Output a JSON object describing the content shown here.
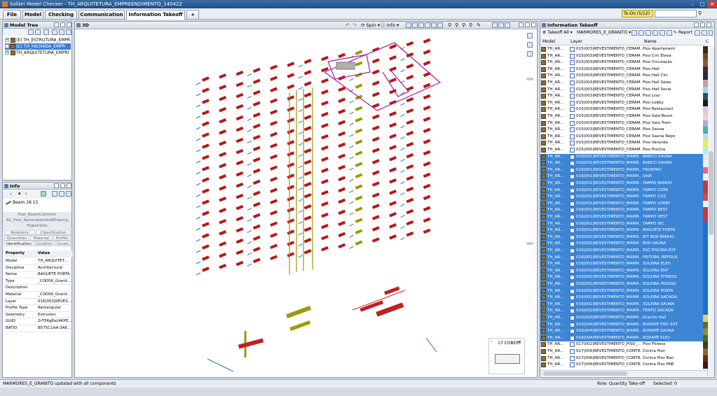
{
  "app": {
    "title": "Solibri Model Checker - TH_ARQUITETURA_EMPREENDIMENTO_140422"
  },
  "tabs": [
    {
      "label": "File"
    },
    {
      "label": "Model"
    },
    {
      "label": "Checking"
    },
    {
      "label": "Communication"
    },
    {
      "label": "Information Takeoff"
    },
    {
      "label": "+"
    }
  ],
  "todo": {
    "label": "To-Do (5/12)"
  },
  "model_tree": {
    "title": "Model Tree",
    "items": [
      {
        "label": "(E) TH_ESTRUTURA_EMPR"
      },
      {
        "label": "(C) TH_FACHADA_EMPR"
      },
      {
        "label": "TH_ARQUITETURA_EMPRI"
      }
    ]
  },
  "info": {
    "title": "Info",
    "selected": "Beam.18.15",
    "sections": [
      "Pset_BeamCommon",
      "AC_Pset_RenovationAndPhasing",
      "Hyperlinks"
    ],
    "tabs_row1": [
      "Relations",
      "Classification"
    ],
    "tabs_row2": [
      "Quantities",
      "Material",
      "Profile"
    ],
    "tabs_row3": [
      "Identification",
      "Location",
      "Issues"
    ],
    "col_property": "Property",
    "col_value": "Value",
    "properties": [
      {
        "p": "Model",
        "v": "TH_ARQUITET..."
      },
      {
        "p": "Discipline",
        "v": "Architectural"
      },
      {
        "p": "Name",
        "v": "BAGUETE PORTA"
      },
      {
        "p": "Type",
        "v": "_COD56_Granit..."
      },
      {
        "p": "Description",
        "v": ""
      },
      {
        "p": "Material",
        "v": "_COD56_Granit..."
      },
      {
        "p": "Layer",
        "v": "016|002|REVES..."
      },
      {
        "p": "Profile Type",
        "v": "Rectangular"
      },
      {
        "p": "Geometry",
        "v": "Extrusion"
      },
      {
        "p": "GUID",
        "v": "2rT56gEeL4KPE..."
      },
      {
        "p": "BATID",
        "v": "B575C1AA-3A8..."
      }
    ]
  },
  "view3d": {
    "title": "3D",
    "spin": "Spin",
    "info": "Info",
    "floor_label": "17 COBERT"
  },
  "takeoff": {
    "title": "Information Takeoff",
    "takeoff_all": "Takeoff All",
    "definition": "MARMORES_E_GRANITO",
    "report": "Report",
    "col_model": "Model",
    "col_layer": "Layer",
    "col_name": "Name",
    "col_c": "C",
    "rows": [
      {
        "m": "TH_AR...",
        "l": "015|003|REVESTIMENTO_CERAM...",
        "n": "Piso Apartament",
        "sel": false,
        "c": "#3a2a1a"
      },
      {
        "m": "TH_AR...",
        "l": "015|003|REVESTIMENTO_CERAM...",
        "n": "Piso Circ Eleva",
        "sel": false,
        "c": "#6b4a2a"
      },
      {
        "m": "TH_AR...",
        "l": "015|003|REVESTIMENTO_CERAM...",
        "n": "Piso Circulação",
        "sel": false,
        "c": "#8a5a3a"
      },
      {
        "m": "TH_AR...",
        "l": "015|003|REVESTIMENTO_CERAM...",
        "n": "Piso Hall",
        "sel": false,
        "c": "#4a2a2a"
      },
      {
        "m": "TH_AR...",
        "l": "015|003|REVESTIMENTO_CERAM...",
        "n": "Piso Hall Circ",
        "sel": false,
        "c": "#2a2a3a"
      },
      {
        "m": "TH_AR...",
        "l": "015|003|REVESTIMENTO_CERAM...",
        "n": "Piso Hall Salas",
        "sel": false,
        "c": "#c8a0a0"
      },
      {
        "m": "TH_AR...",
        "l": "015|003|REVESTIMENTO_CERAM...",
        "n": "Piso Hall Socia",
        "sel": false,
        "c": "#9ad8e8"
      },
      {
        "m": "TH_AR...",
        "l": "015|003|REVESTIMENTO_CERAM...",
        "n": "Piso Lixo",
        "sel": false,
        "c": "#3a4a6a"
      },
      {
        "m": "TH_AR...",
        "l": "015|003|REVESTIMENTO_CERAM...",
        "n": "Piso Lobby",
        "sel": false,
        "c": "#1a1a1a"
      },
      {
        "m": "TH_AR...",
        "l": "015|003|REVESTIMENTO_CERAM...",
        "n": "Piso Restaurant",
        "sel": false,
        "c": "#d8c8e8"
      },
      {
        "m": "TH_AR...",
        "l": "015|003|REVESTIMENTO_CERAM...",
        "n": "Piso Sala Reuni",
        "sel": false,
        "c": "#e8d0d8"
      },
      {
        "m": "TH_AR...",
        "l": "015|003|REVESTIMENTO_CERAM...",
        "n": "Piso Sala Trein",
        "sel": false,
        "c": "#b8a8d8"
      },
      {
        "m": "TH_AR...",
        "l": "015|003|REVESTIMENTO_CERAM...",
        "n": "Piso Sauna",
        "sel": false,
        "c": "#3ab8a8"
      },
      {
        "m": "TH_AR...",
        "l": "015|003|REVESTIMENTO_CERAM...",
        "n": "Piso Sauna Repo",
        "sel": false,
        "c": "#c8d8f0"
      },
      {
        "m": "TH_AR...",
        "l": "015|003|REVESTIMENTO_CERAM...",
        "n": "Piso Varanda",
        "sel": false,
        "c": "#e8f048"
      },
      {
        "m": "TH_AR...",
        "l": "015|005|REVESTIMENTO_CERAM...",
        "n": "Piso Piscina",
        "sel": false,
        "c": "#b8e8f0"
      },
      {
        "m": "TH_AR...",
        "l": "016|001|REVESTIMENTO_MARM...",
        "n": "BANCO SAUNA",
        "sel": true,
        "c": "#e8e8e8"
      },
      {
        "m": "TH_AR...",
        "l": "016|001|REVESTIMENTO_MARM...",
        "n": "BANCO SAUNA",
        "sel": true,
        "c": "#f0f0f0"
      },
      {
        "m": "TH_AR...",
        "l": "016|001|REVESTIMENTO_MARM...",
        "n": "FRONTAO",
        "sel": true,
        "c": "#e86878"
      },
      {
        "m": "TH_AR...",
        "l": "016|001|REVESTIMENTO_MARM...",
        "n": "SAIA",
        "sel": true,
        "c": "#f0f0f0"
      },
      {
        "m": "TH_AR...",
        "l": "016|001|REVESTIMENTO_MARM...",
        "n": "TAMPO BANHO",
        "sel": true,
        "c": "#c83838"
      },
      {
        "m": "TH_AR...",
        "l": "016|001|REVESTIMENTO_MARM...",
        "n": "TAMPO COPA",
        "sel": true,
        "c": "#c83838"
      },
      {
        "m": "TH_AR...",
        "l": "016|001|REVESTIMENTO_MARM...",
        "n": "TAMPO COZ",
        "sel": true,
        "c": "#d84848"
      },
      {
        "m": "TH_AR...",
        "l": "016|001|REVESTIMENTO_MARM...",
        "n": "TAMPO LOBBY",
        "sel": true,
        "c": "#f0f0f0"
      },
      {
        "m": "TH_AR...",
        "l": "016|001|REVESTIMENTO_MARM...",
        "n": "TAMPO REST",
        "sel": true,
        "c": "#c83838"
      },
      {
        "m": "TH_AR...",
        "l": "016|001|REVESTIMENTO_MARM...",
        "n": "TAMPO VEST",
        "sel": true,
        "c": "#c83838"
      },
      {
        "m": "TH_AR...",
        "l": "016|001|REVESTIMENTO_MARM...",
        "n": "TAMPO WC",
        "sel": true,
        "c": "#1f6fd0"
      },
      {
        "m": "TH_AR...",
        "l": "016|002|REVESTIMENTO_MARM...",
        "n": "BAGUETE PORTA",
        "sel": true,
        "c": "#1f6fd0"
      },
      {
        "m": "TH_AR...",
        "l": "016|002|REVESTIMENTO_MARM...",
        "n": "BIT BOX BANHO",
        "sel": true,
        "c": "#1f6fd0"
      },
      {
        "m": "TH_AR...",
        "l": "016|002|REVESTIMENTO_MARM...",
        "n": "BOX SAUNA",
        "sel": true,
        "c": "#1f6fd0"
      },
      {
        "m": "TH_AR...",
        "l": "016|002|REVESTIMENTO_MARM...",
        "n": "ESC PISCINA EXT",
        "sel": true,
        "c": "#1f6fd0"
      },
      {
        "m": "TH_AR...",
        "l": "016|002|REVESTIMENTO_MARM...",
        "n": "PEITORIL REPOUS",
        "sel": true,
        "c": "#1f6fd0"
      },
      {
        "m": "TH_AR...",
        "l": "016|002|REVESTIMENTO_MARM...",
        "n": "SOLEIRA ELEV",
        "sel": true,
        "c": "#1f6fd0"
      },
      {
        "m": "TH_AR...",
        "l": "016|002|REVESTIMENTO_MARM...",
        "n": "SOLEIRA ENT",
        "sel": true,
        "c": "#1f6fd0"
      },
      {
        "m": "TH_AR...",
        "l": "016|002|REVESTIMENTO_MARM...",
        "n": "SOLEIRA FITNESS",
        "sel": true,
        "c": "#1f6fd0"
      },
      {
        "m": "TH_AR...",
        "l": "016|002|REVESTIMENTO_MARM...",
        "n": "SOLEIRA PASSAG",
        "sel": true,
        "c": "#1f6fd0"
      },
      {
        "m": "TH_AR...",
        "l": "016|002|REVESTIMENTO_MARM...",
        "n": "SOLEIRA PORTA",
        "sel": true,
        "c": "#1f6fd0"
      },
      {
        "m": "TH_AR...",
        "l": "016|002|REVESTIMENTO_MARM...",
        "n": "SOLEIRA SACADA",
        "sel": true,
        "c": "#1f6fd0"
      },
      {
        "m": "TH_AR...",
        "l": "016|002|REVESTIMENTO_MARM...",
        "n": "SOLEIRA SAUNA",
        "sel": true,
        "c": "#1f6fd0"
      },
      {
        "m": "TH_AR...",
        "l": "016|002|REVESTIMENTO_MARM...",
        "n": "TENTO SACADA",
        "sel": true,
        "c": "#1f6fd0"
      },
      {
        "m": "TH_AR...",
        "l": "016|003|REVESTIMENTO_MARM...",
        "n": "Granito Hall",
        "sel": true,
        "c": "#d8d858"
      },
      {
        "m": "TH_AR...",
        "l": "016|004|REVESTIMENTO_MARM...",
        "n": "RODAPÉ PISC EXT",
        "sel": true,
        "c": "#6a6a2a"
      },
      {
        "m": "TH_AR...",
        "l": "016|004|REVESTIMENTO_MARM...",
        "n": "RODAPÉ SAUNA",
        "sel": true,
        "c": "#8a8a3a"
      },
      {
        "m": "TH_AR...",
        "l": "016|004|REVESTIMENTO_MARM...",
        "n": "RODAPÉ ELEV",
        "sel": true,
        "c": "#4a6a1a"
      },
      {
        "m": "TH_AR...",
        "l": "017|002|REVESTIMENTO_PISO_...",
        "n": "Piso Fitness",
        "sel": false,
        "c": "#2a4a1a"
      },
      {
        "m": "TH_AR...",
        "l": "017|006|REVESTIMENTO_CONTR...",
        "n": "Contra Piso",
        "sel": false,
        "c": "#8a6a2a"
      },
      {
        "m": "TH_AR...",
        "l": "017|006|REVESTIMENTO_CONTR...",
        "n": "Contra Piso Ban",
        "sel": false,
        "c": "#6a2a1a"
      },
      {
        "m": "TH_AR...",
        "l": "017|006|REVESTIMENTO_CONTR...",
        "n": "Contra Piso PNE",
        "sel": false,
        "c": "#3a1a0a"
      }
    ]
  },
  "status": {
    "message": "MARMORES_E_GRANITO updated with all components",
    "role": "Role: Quantity Take-off",
    "selected": "Selected: 0"
  }
}
